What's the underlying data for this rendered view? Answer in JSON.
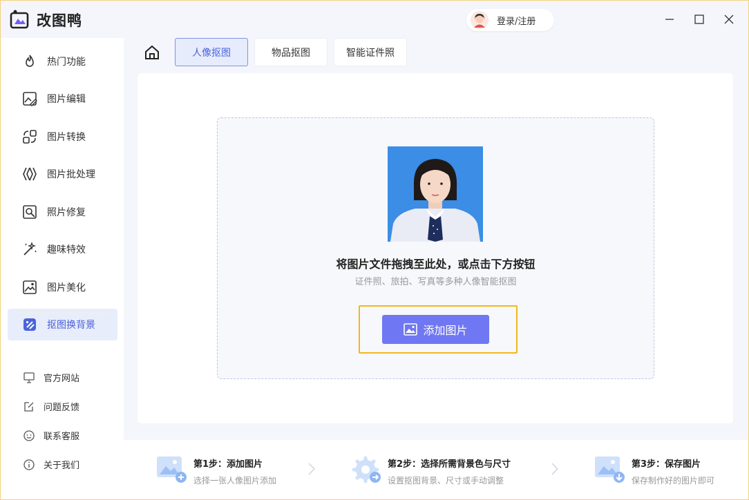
{
  "app": {
    "name": "改图鸭",
    "login_label": "登录/注册"
  },
  "sidebar": {
    "items": [
      {
        "label": "热门功能",
        "icon": "flame-icon"
      },
      {
        "label": "图片编辑",
        "icon": "image-edit-icon"
      },
      {
        "label": "图片转换",
        "icon": "convert-icon"
      },
      {
        "label": "图片批处理",
        "icon": "batch-icon"
      },
      {
        "label": "照片修复",
        "icon": "photo-repair-icon"
      },
      {
        "label": "趣味特效",
        "icon": "magic-wand-icon"
      },
      {
        "label": "图片美化",
        "icon": "image-beautify-icon"
      },
      {
        "label": "抠图换背景",
        "icon": "cutout-icon",
        "active": true
      }
    ],
    "links": [
      {
        "label": "官方网站",
        "icon": "monitor-icon"
      },
      {
        "label": "问题反馈",
        "icon": "feedback-icon"
      },
      {
        "label": "联系客服",
        "icon": "support-icon"
      },
      {
        "label": "关于我们",
        "icon": "info-icon"
      }
    ]
  },
  "tabs": [
    {
      "label": "人像抠图",
      "active": true
    },
    {
      "label": "物品抠图"
    },
    {
      "label": "智能证件照"
    }
  ],
  "upload": {
    "title": "将图片文件拖拽至此处，或点击下方按钮",
    "subtitle": "证件照、旅拍、写真等多种人像智能抠图",
    "button_label": "添加图片"
  },
  "steps": [
    {
      "title": "第1步：添加图片",
      "desc": "选择一张人像图片添加"
    },
    {
      "title": "第2步：选择所需背景色与尺寸",
      "desc": "设置抠图背景、尺寸或手动调整"
    },
    {
      "title": "第3步：保存图片",
      "desc": "保存制作好的图片即可"
    }
  ],
  "colors": {
    "accent": "#6f77f2",
    "active_tab": "#4a63dc",
    "highlight": "#f2b71d",
    "photo_bg": "#3b8de6"
  }
}
